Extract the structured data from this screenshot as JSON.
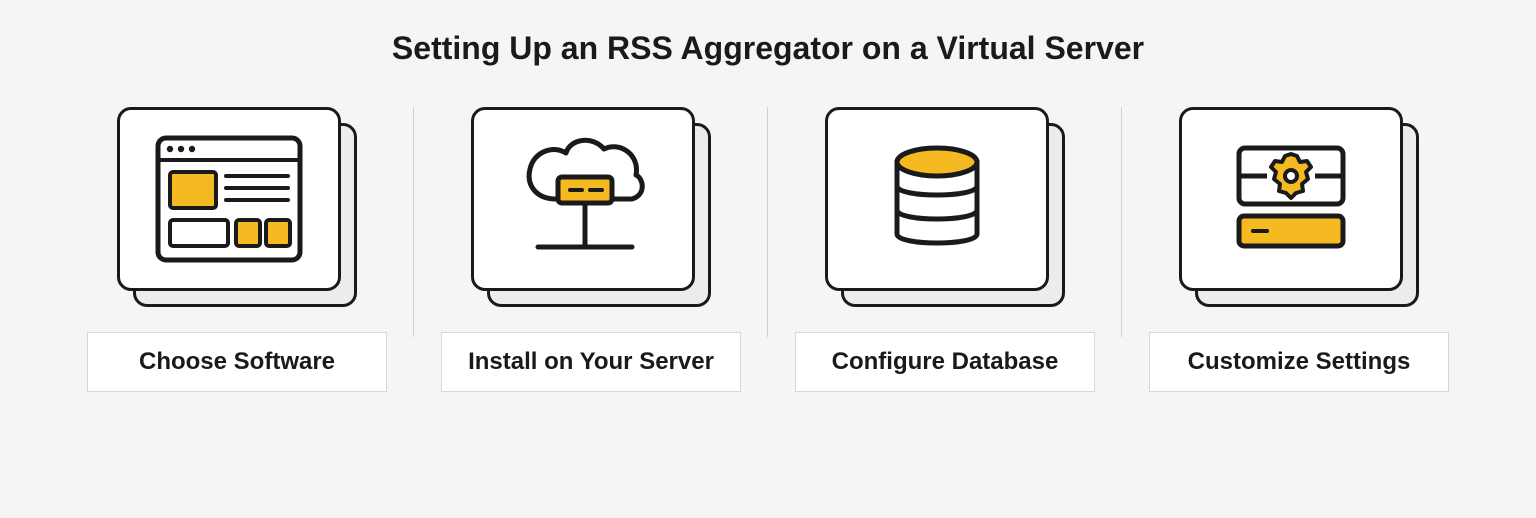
{
  "title": "Setting Up an RSS Aggregator on a Virtual Server",
  "steps": [
    {
      "label": "Choose Software",
      "icon": "browser-layout-icon"
    },
    {
      "label": "Install on Your Server",
      "icon": "cloud-download-icon"
    },
    {
      "label": "Configure Database",
      "icon": "database-icon"
    },
    {
      "label": "Customize Settings",
      "icon": "gear-settings-icon"
    }
  ],
  "colors": {
    "accent": "#f5b921",
    "line": "#1a1a1a",
    "cardBg": "#ffffff",
    "backCardBg": "#ececec",
    "pageBg": "#f5f5f4"
  }
}
